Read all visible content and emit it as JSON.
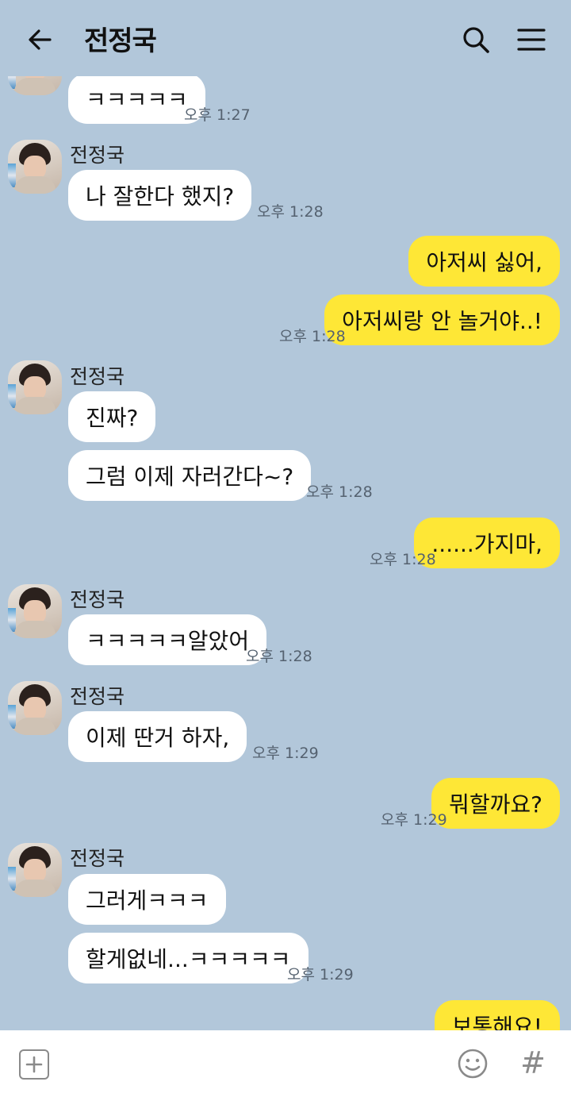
{
  "header": {
    "title": "전정국"
  },
  "icons": {
    "back": "arrow-left-icon",
    "search": "search-icon",
    "menu": "hamburger-menu-icon",
    "add": "plus-square-icon",
    "emoji": "smiley-icon",
    "hashtag": "hash-icon"
  },
  "colors": {
    "background": "#b2c7da",
    "incoming_bubble": "#ffffff",
    "outgoing_bubble": "#fee736"
  },
  "messages": [
    {
      "id": "m1",
      "dir": "in",
      "text": "ㅋㅋㅋㅋㅋ",
      "time": "오후 1:27"
    },
    {
      "id": "m2",
      "dir": "in",
      "sender": "전정국",
      "text": "나 잘한다 했지?",
      "time": "오후 1:28"
    },
    {
      "id": "m3",
      "dir": "out",
      "text": "아저씨 싫어,"
    },
    {
      "id": "m4",
      "dir": "out",
      "text": "아저씨랑 안 놀거야..!",
      "time": "오후 1:28"
    },
    {
      "id": "m5",
      "dir": "in",
      "sender": "전정국",
      "text": "진짜?"
    },
    {
      "id": "m6",
      "dir": "in",
      "text": "그럼 이제 자러간다~?",
      "time": "오후 1:28"
    },
    {
      "id": "m7",
      "dir": "out",
      "text": "......가지마,",
      "time": "오후 1:28"
    },
    {
      "id": "m8",
      "dir": "in",
      "sender": "전정국",
      "text": "ㅋㅋㅋㅋㅋ알았어",
      "time": "오후 1:28"
    },
    {
      "id": "m9",
      "dir": "in",
      "sender": "전정국",
      "text": "이제 딴거 하자,",
      "time": "오후 1:29"
    },
    {
      "id": "m10",
      "dir": "out",
      "text": "뭐할까요?",
      "time": "오후 1:29"
    },
    {
      "id": "m11",
      "dir": "in",
      "sender": "전정국",
      "text": "그러게ㅋㅋㅋ"
    },
    {
      "id": "m12",
      "dir": "in",
      "text": "할게없네...ㅋㅋㅋㅋㅋ",
      "time": "오후 1:29"
    },
    {
      "id": "m13",
      "dir": "out",
      "text": "보통해요!"
    }
  ],
  "composer": {
    "hash_symbol": "#"
  }
}
